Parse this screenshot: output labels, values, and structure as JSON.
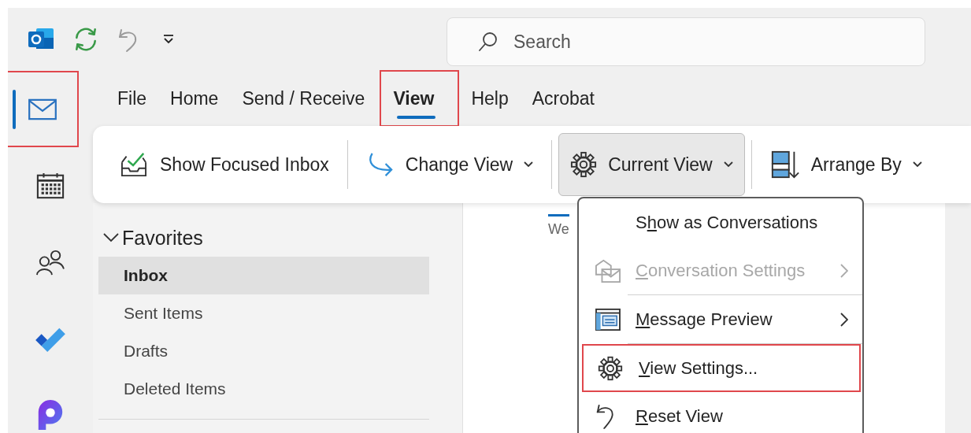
{
  "search": {
    "placeholder": "Search"
  },
  "rail": [
    {
      "kind": "mail",
      "selected": true,
      "highlighted": true
    },
    {
      "kind": "calendar",
      "selected": false,
      "highlighted": false
    },
    {
      "kind": "people",
      "selected": false,
      "highlighted": false
    },
    {
      "kind": "todo",
      "selected": false,
      "highlighted": false
    },
    {
      "kind": "loop",
      "selected": false,
      "highlighted": false
    }
  ],
  "tabs": [
    {
      "label": "File",
      "selected": false,
      "highlighted": false
    },
    {
      "label": "Home",
      "selected": false,
      "highlighted": false
    },
    {
      "label": "Send / Receive",
      "selected": false,
      "highlighted": false
    },
    {
      "label": "View",
      "selected": true,
      "highlighted": true
    },
    {
      "label": "Help",
      "selected": false,
      "highlighted": false
    },
    {
      "label": "Acrobat",
      "selected": false,
      "highlighted": false
    }
  ],
  "ribbon": [
    {
      "kind": "focused",
      "label": "Show Focused Inbox",
      "dropdown": false,
      "pressed": false
    },
    {
      "kind": "change",
      "label": "Change View",
      "dropdown": true,
      "pressed": false
    },
    {
      "kind": "current",
      "label": "Current View",
      "dropdown": true,
      "pressed": true
    },
    {
      "kind": "arrange",
      "label": "Arrange By",
      "dropdown": true,
      "pressed": false
    }
  ],
  "folders": {
    "header": "Favorites",
    "expanded": true,
    "items": [
      {
        "label": "Inbox",
        "selected": true
      },
      {
        "label": "Sent Items",
        "selected": false
      },
      {
        "label": "Drafts",
        "selected": false
      },
      {
        "label": "Deleted Items",
        "selected": false
      }
    ]
  },
  "list_tab": {
    "label": "We",
    "selected": true
  },
  "menu": [
    {
      "kind": "none",
      "parts": [
        {
          "text": "S",
          "underline": false
        },
        {
          "text": "h",
          "underline": true
        },
        {
          "text": "ow as Conversations",
          "underline": false
        }
      ],
      "disabled": false,
      "submenu": false,
      "highlighted": false,
      "separator_before": false
    },
    {
      "kind": "conversation",
      "parts": [
        {
          "text": "C",
          "underline": true
        },
        {
          "text": "onversation Settings",
          "underline": false
        }
      ],
      "disabled": true,
      "submenu": true,
      "highlighted": false,
      "separator_before": false
    },
    {
      "kind": "preview",
      "parts": [
        {
          "text": "M",
          "underline": true
        },
        {
          "text": "essage Preview",
          "underline": false
        }
      ],
      "disabled": false,
      "submenu": true,
      "highlighted": false,
      "separator_before": true
    },
    {
      "kind": "gear",
      "parts": [
        {
          "text": "V",
          "underline": true
        },
        {
          "text": "iew Settings...",
          "underline": false
        }
      ],
      "disabled": false,
      "submenu": false,
      "highlighted": true,
      "separator_before": true
    },
    {
      "kind": "reset",
      "parts": [
        {
          "text": "R",
          "underline": true
        },
        {
          "text": "eset View",
          "underline": false
        }
      ],
      "disabled": false,
      "submenu": false,
      "highlighted": false,
      "separator_before": false
    }
  ]
}
